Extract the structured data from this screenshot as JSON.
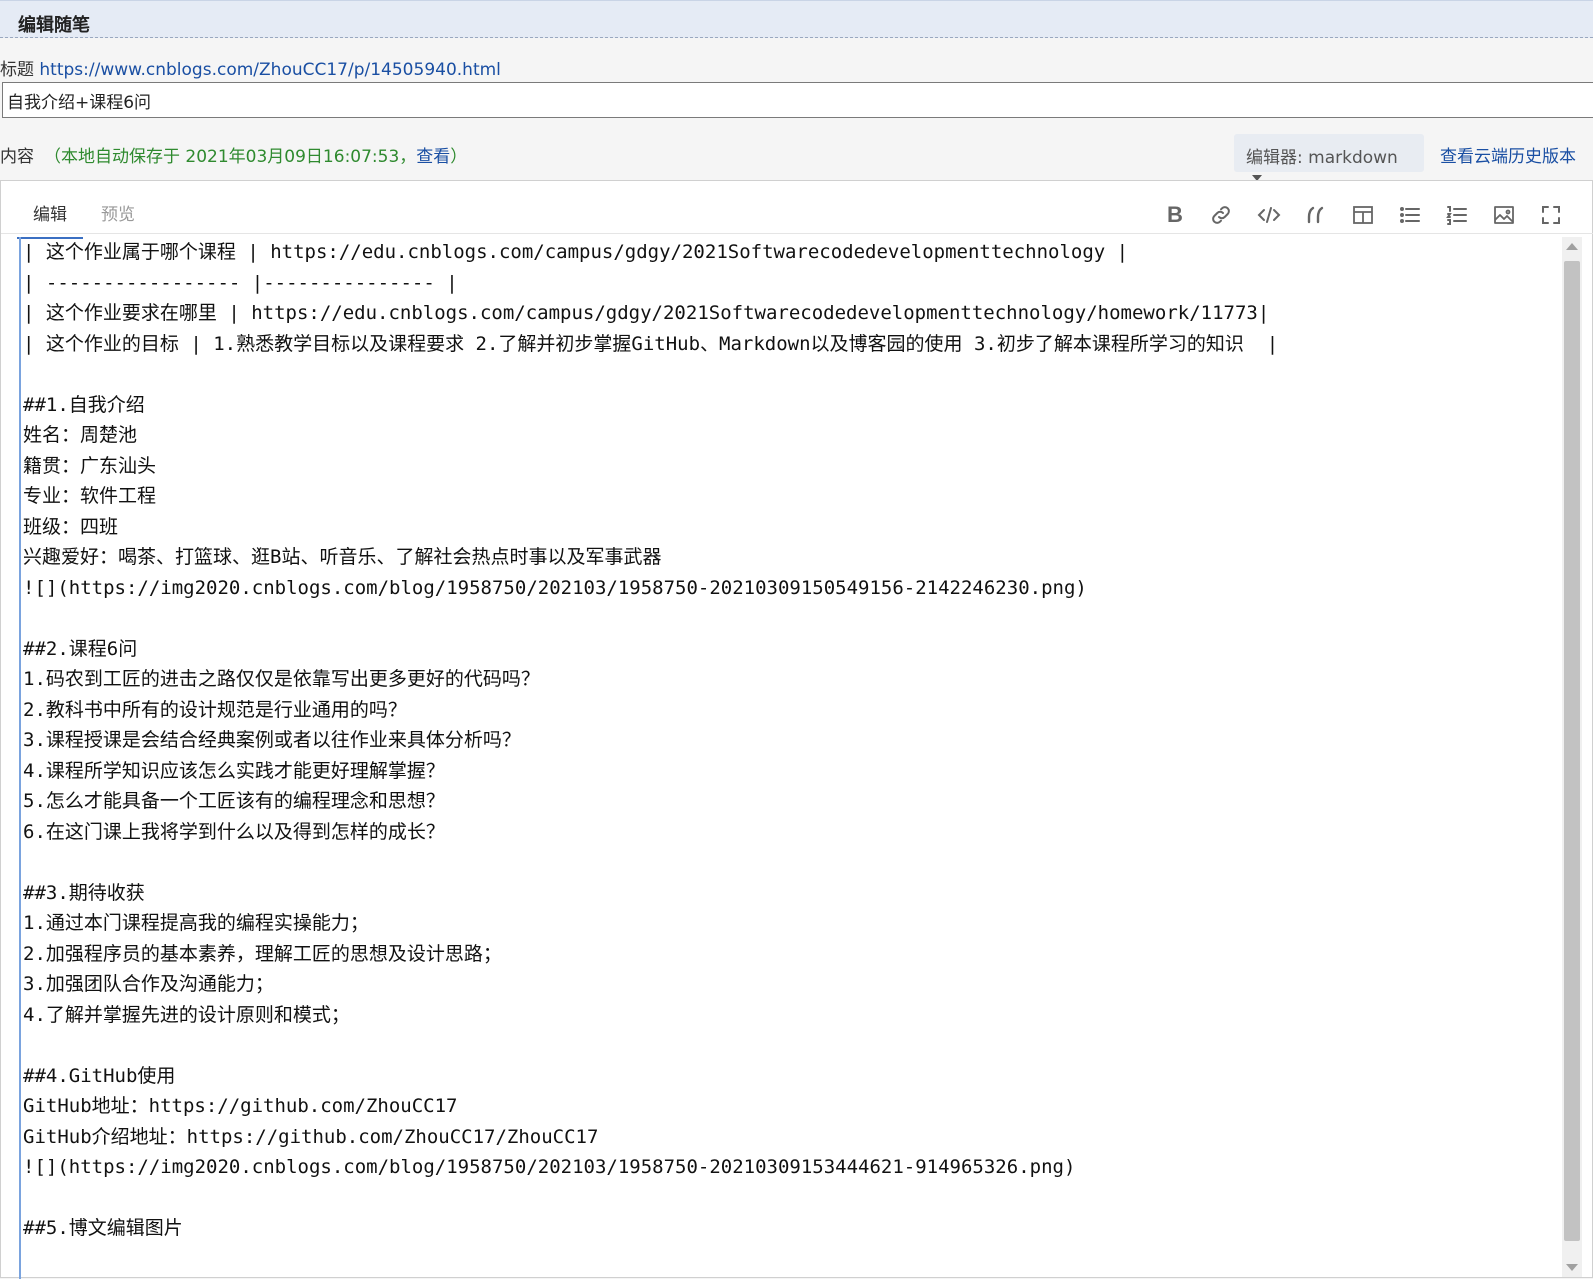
{
  "header": {
    "title": "编辑随笔"
  },
  "title_field": {
    "label": "标题",
    "link": "https://www.cnblogs.com/ZhouCC17/p/14505940.html",
    "value": "自我介绍+课程6问"
  },
  "content_field": {
    "label": "内容",
    "autosave_prefix": "（本地自动保存于 2021年03月09日16:07:53，",
    "autosave_link": "查看",
    "autosave_suffix": "）"
  },
  "editor_select": {
    "label": "编辑器: markdown"
  },
  "cloud_history": "查看云端历史版本",
  "tabs": [
    {
      "label": "编辑"
    },
    {
      "label": "预览"
    }
  ],
  "toolbar": [
    {
      "icon": "bold-icon"
    },
    {
      "icon": "link-icon"
    },
    {
      "icon": "code-icon"
    },
    {
      "icon": "quote-icon"
    },
    {
      "icon": "table-icon"
    },
    {
      "icon": "unordered-list-icon"
    },
    {
      "icon": "ordered-list-icon"
    },
    {
      "icon": "image-icon"
    },
    {
      "icon": "fullscreen-icon"
    }
  ],
  "markdown_lines": [
    "| 这个作业属于哪个课程 | https://edu.cnblogs.com/campus/gdgy/2021Softwarecodedevelopmenttechnology |",
    "| ----------------- |--------------- |",
    "| 这个作业要求在哪里 | https://edu.cnblogs.com/campus/gdgy/2021Softwarecodedevelopmenttechnology/homework/11773|",
    "| 这个作业的目标 | 1.熟悉教学目标以及课程要求 2.了解并初步掌握GitHub、Markdown以及博客园的使用 3.初步了解本课程所学习的知识  |",
    "",
    "##1.自我介绍",
    "姓名：周楚池",
    "籍贯：广东汕头",
    "专业：软件工程",
    "班级：四班",
    "兴趣爱好：喝茶、打篮球、逛B站、听音乐、了解社会热点时事以及军事武器",
    "![](https://img2020.cnblogs.com/blog/1958750/202103/1958750-20210309150549156-2142246230.png)",
    "",
    "##2.课程6问",
    "1.码农到工匠的进击之路仅仅是依靠写出更多更好的代码吗？",
    "2.教科书中所有的设计规范是行业通用的吗？",
    "3.课程授课是会结合经典案例或者以往作业来具体分析吗？",
    "4.课程所学知识应该怎么实践才能更好理解掌握？",
    "5.怎么才能具备一个工匠该有的编程理念和思想？",
    "6.在这门课上我将学到什么以及得到怎样的成长？",
    "",
    "##3.期待收获",
    "1.通过本门课程提高我的编程实操能力；",
    "2.加强程序员的基本素养，理解工匠的思想及设计思路；",
    "3.加强团队合作及沟通能力；",
    "4.了解并掌握先进的设计原则和模式；",
    "",
    "##4.GitHub使用",
    "GitHub地址：https://github.com/ZhouCC17",
    "GitHub介绍地址：https://github.com/ZhouCC17/ZhouCC17",
    "![](https://img2020.cnblogs.com/blog/1958750/202103/1958750-20210309153444621-914965326.png)",
    "",
    "##5.博文编辑图片"
  ]
}
